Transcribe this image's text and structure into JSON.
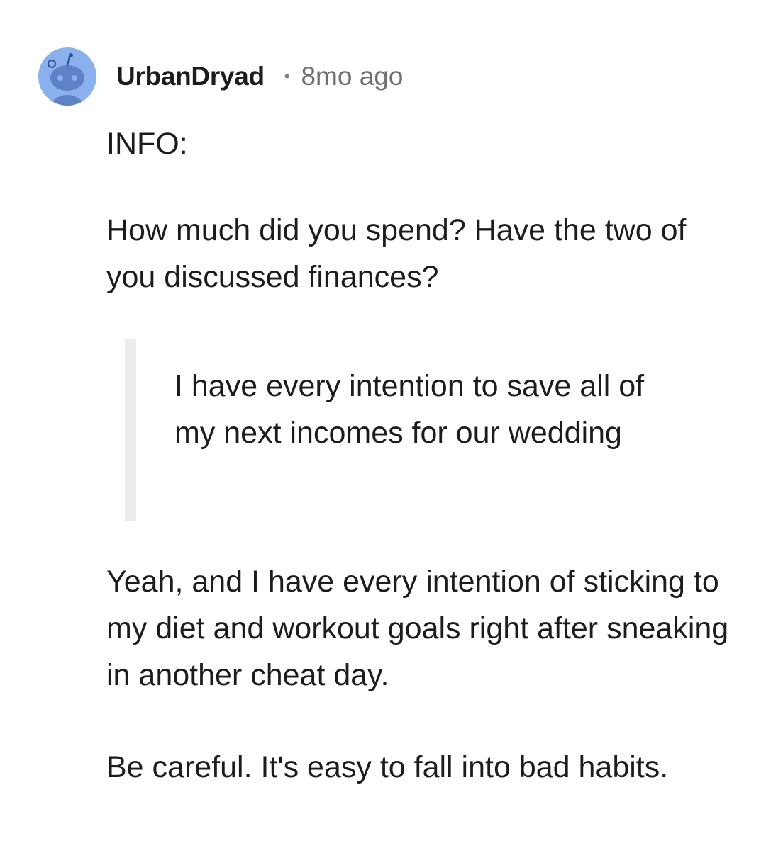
{
  "comment": {
    "author": "UrbanDryad",
    "separator": "•",
    "timestamp": "8mo ago",
    "avatar_icon": "reddit-snoo-icon",
    "paragraphs": {
      "info": "INFO:",
      "question": "How much did you spend? Have the two of you discussed finances?",
      "quote": "I have every intention to save all of my next incomes for our wedding",
      "reply": "Yeah, and I have every intention of sticking to my diet and workout goals right after sneaking in another cheat day.",
      "advice": "Be careful. It's easy to fall into bad habits."
    }
  },
  "colors": {
    "avatar_bg": "#8ab0ee",
    "avatar_figure": "#5f82c6",
    "quote_bar": "#ededed",
    "text": "#1c1c1c",
    "meta": "#6f6f6f"
  }
}
